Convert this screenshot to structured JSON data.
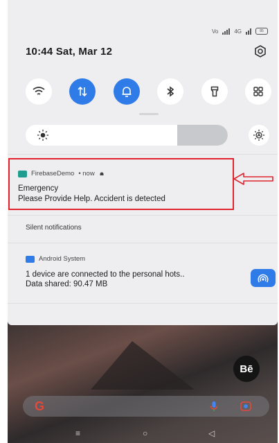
{
  "status_bar": {
    "network_label": "Vo",
    "lte_label": "4G",
    "battery_label": "85"
  },
  "header": {
    "datetime": "10:44  Sat, Mar 12"
  },
  "quick_settings": [
    {
      "name": "wifi-icon",
      "on": false
    },
    {
      "name": "mobile-data-icon",
      "on": true
    },
    {
      "name": "bell-icon",
      "on": true
    },
    {
      "name": "bluetooth-icon",
      "on": false
    },
    {
      "name": "flashlight-icon",
      "on": false
    },
    {
      "name": "grid-icon",
      "on": false
    }
  ],
  "brightness": {
    "level": 0.75
  },
  "notifications": [
    {
      "app": "FirebaseDemo",
      "meta": "• now",
      "title": "Emergency",
      "body": "Please Provide Help. Accident is detected",
      "icon_color": "#1f9e8f"
    }
  ],
  "silent_header": "Silent notifications",
  "silent_notifications": [
    {
      "app": "Android System",
      "line1": "1 device are connected to the personal hots..",
      "line2": "Data shared: 90.47 MB",
      "icon_color": "#2f7be8"
    }
  ],
  "home": {
    "behance_label": "Bē",
    "google_label": "G"
  },
  "colors": {
    "accent": "#2f7be8",
    "highlight": "#e0232d",
    "panel": "#eeeef0"
  }
}
